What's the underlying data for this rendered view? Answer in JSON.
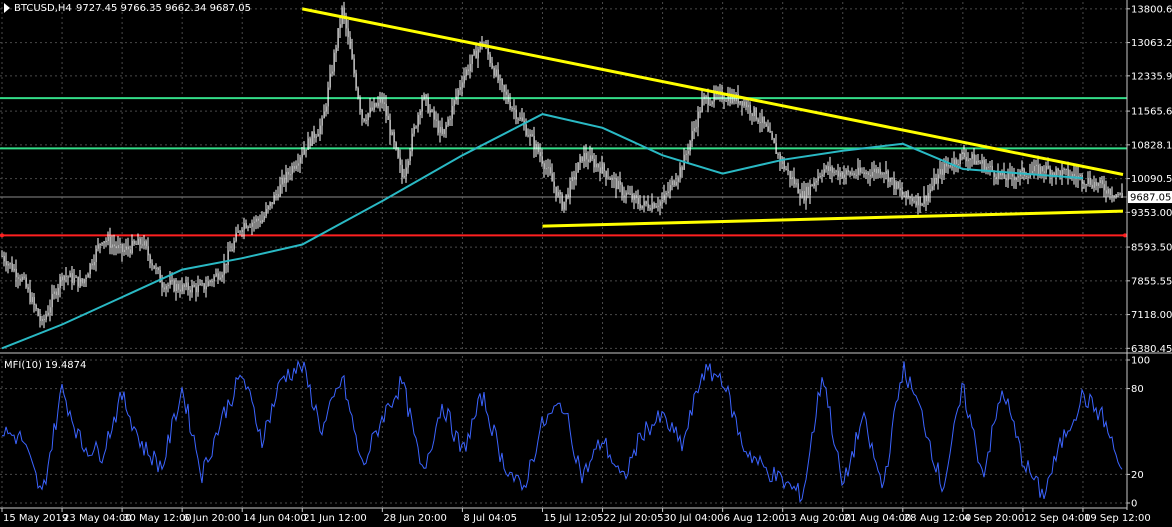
{
  "symbol_header": "BTCUSD,H4",
  "ohlc_header": "9727.45 9766.35 9662.34 9687.05",
  "indicator_header": "MFI(10) 19.4874",
  "last_price_label": "9687.05",
  "colors": {
    "background": "#000000",
    "grid": "#4a4a4a",
    "candles": "#ffffff",
    "moving_average": "#2ab9c4",
    "trendlines": "#ffff00",
    "horizontal_levels": "#33dd88",
    "support_level": "#ff2020",
    "mfi_line": "#3c64ff"
  },
  "chart_data": [
    {
      "type": "candlestick",
      "title": "BTCUSD,H4",
      "y_ticks": [
        "13800.65",
        "13063.25",
        "12335.90",
        "11565.65",
        "10828.10",
        "10090.55",
        "9353.00",
        "8593.50",
        "7855.55",
        "7118.00",
        "6380.45"
      ],
      "ylim": [
        6300,
        13950
      ],
      "x_ticks": [
        "15 May 2019",
        "23 May 04:00",
        "30 May 12:00",
        "6 Jun 20:00",
        "14 Jun 04:00",
        "21 Jun 12:00",
        "28 Jun 20:00",
        "8 Jul 04:05",
        "15 Jul 12:05",
        "22 Jul 20:05",
        "30 Jul 04:00",
        "6 Aug 12:00",
        "13 Aug 20:00",
        "21 Aug 04:00",
        "28 Aug 12:00",
        "4 Sep 20:00",
        "12 Sep 04:00",
        "19 Sep 12:00"
      ],
      "grid": true,
      "price_path": [
        [
          "15 May 2019",
          8400
        ],
        [
          "18 May",
          7900
        ],
        [
          "20 May",
          6900
        ],
        [
          "23 May 04:00",
          8000
        ],
        [
          "26 May",
          7800
        ],
        [
          "28 May",
          8800
        ],
        [
          "30 May 12:00",
          8500
        ],
        [
          "1 Jun",
          8700
        ],
        [
          "3 Jun",
          7800
        ],
        [
          "6 Jun 20:00",
          7700
        ],
        [
          "9 Jun",
          7700
        ],
        [
          "12 Jun",
          8100
        ],
        [
          "14 Jun 04:00",
          9100
        ],
        [
          "17 Jun",
          9200
        ],
        [
          "19 Jun",
          10000
        ],
        [
          "21 Jun 12:00",
          10700
        ],
        [
          "23 Jun",
          11300
        ],
        [
          "26 Jun",
          13800
        ],
        [
          "27 Jun",
          11400
        ],
        [
          "28 Jun 20:00",
          11800
        ],
        [
          "1 Jul",
          10100
        ],
        [
          "3 Jul",
          11900
        ],
        [
          "5 Jul",
          11000
        ],
        [
          "8 Jul 04:05",
          12300
        ],
        [
          "10 Jul",
          13100
        ],
        [
          "11 Jul",
          12000
        ],
        [
          "13 Jul",
          11300
        ],
        [
          "15 Jul 12:05",
          10500
        ],
        [
          "17 Jul",
          9500
        ],
        [
          "19 Jul",
          10600
        ],
        [
          "22 Jul 20:05",
          10300
        ],
        [
          "25 Jul",
          9800
        ],
        [
          "28 Jul",
          9500
        ],
        [
          "30 Jul 04:00",
          9600
        ],
        [
          "2 Aug",
          10400
        ],
        [
          "4 Aug",
          11800
        ],
        [
          "6 Aug 12:00",
          11900
        ],
        [
          "9 Aug",
          11800
        ],
        [
          "11 Aug",
          11300
        ],
        [
          "13 Aug 20:00",
          10400
        ],
        [
          "15 Aug",
          9700
        ],
        [
          "17 Aug",
          10300
        ],
        [
          "21 Aug 04:00",
          10200
        ],
        [
          "23 Aug",
          10200
        ],
        [
          "26 Aug",
          10300
        ],
        [
          "28 Aug 12:00",
          9700
        ],
        [
          "31 Aug",
          9600
        ],
        [
          "2 Sep",
          10300
        ],
        [
          "4 Sep 20:00",
          10600
        ],
        [
          "7 Sep",
          10400
        ],
        [
          "10 Sep",
          10100
        ],
        [
          "12 Sep 04:00",
          10200
        ],
        [
          "15 Sep",
          10300
        ],
        [
          "17 Sep",
          10200
        ],
        [
          "19 Sep 12:00",
          10100
        ],
        [
          "20 Sep",
          9900
        ],
        [
          "21 Sep",
          9687.05
        ]
      ],
      "moving_average": [
        [
          "15 May 2019",
          6380
        ],
        [
          "23 May 04:00",
          6900
        ],
        [
          "30 May 12:00",
          7500
        ],
        [
          "6 Jun 20:00",
          8100
        ],
        [
          "14 Jun 04:00",
          8350
        ],
        [
          "21 Jun 12:00",
          8650
        ],
        [
          "28 Jun 20:00",
          9600
        ],
        [
          "8 Jul 04:05",
          10600
        ],
        [
          "15 Jul 12:05",
          11500
        ],
        [
          "22 Jul 20:05",
          11200
        ],
        [
          "30 Jul 04:00",
          10600
        ],
        [
          "6 Aug 12:00",
          10200
        ],
        [
          "13 Aug 20:00",
          10500
        ],
        [
          "21 Aug 04:00",
          10700
        ],
        [
          "28 Aug 12:00",
          10850
        ],
        [
          "4 Sep 20:00",
          10300
        ],
        [
          "12 Sep 04:00",
          10200
        ],
        [
          "19 Sep 12:00",
          10100
        ]
      ],
      "horizontal_levels": [
        11850,
        10750
      ],
      "support_level": 8850,
      "trendlines": [
        {
          "from": [
            "21 Jun 12:00",
            13800
          ],
          "to": [
            "21 Sep",
            10180
          ]
        },
        {
          "from": [
            "15 Jul 12:05",
            9050
          ],
          "to": [
            "21 Sep",
            9380
          ]
        }
      ]
    },
    {
      "type": "line",
      "title": "MFI(10) 19.4874",
      "y_ticks": [
        "100",
        "80",
        "20",
        "0"
      ],
      "ylim": [
        0,
        100
      ],
      "grid": true,
      "mfi_path": [
        [
          "15 May 2019",
          50
        ],
        [
          "18 May",
          45
        ],
        [
          "20 May",
          5
        ],
        [
          "23 May 04:00",
          80
        ],
        [
          "26 May",
          40
        ],
        [
          "28 May",
          35
        ],
        [
          "30 May 12:00",
          75
        ],
        [
          "1 Jun",
          40
        ],
        [
          "3 Jun",
          25
        ],
        [
          "6 Jun 20:00",
          80
        ],
        [
          "9 Jun",
          20
        ],
        [
          "12 Jun",
          60
        ],
        [
          "14 Jun 04:00",
          90
        ],
        [
          "17 Jun",
          45
        ],
        [
          "19 Jun",
          88
        ],
        [
          "21 Jun 12:00",
          96
        ],
        [
          "23 Jun",
          50
        ],
        [
          "26 Jun",
          88
        ],
        [
          "27 Jun",
          25
        ],
        [
          "28 Jun 20:00",
          60
        ],
        [
          "1 Jul",
          85
        ],
        [
          "3 Jul",
          20
        ],
        [
          "5 Jul",
          70
        ],
        [
          "8 Jul 04:05",
          35
        ],
        [
          "10 Jul",
          75
        ],
        [
          "11 Jul",
          30
        ],
        [
          "13 Jul",
          8
        ],
        [
          "15 Jul 12:05",
          55
        ],
        [
          "17 Jul",
          70
        ],
        [
          "19 Jul",
          18
        ],
        [
          "22 Jul 20:05",
          45
        ],
        [
          "25 Jul",
          15
        ],
        [
          "28 Jul",
          50
        ],
        [
          "30 Jul 04:00",
          60
        ],
        [
          "2 Aug",
          40
        ],
        [
          "4 Aug",
          92
        ],
        [
          "6 Aug 12:00",
          88
        ],
        [
          "9 Aug",
          40
        ],
        [
          "11 Aug",
          25
        ],
        [
          "13 Aug 20:00",
          15
        ],
        [
          "15 Aug",
          5
        ],
        [
          "17 Aug",
          92
        ],
        [
          "21 Aug 04:00",
          10
        ],
        [
          "23 Aug",
          60
        ],
        [
          "26 Aug",
          10
        ],
        [
          "28 Aug 12:00",
          95
        ],
        [
          "31 Aug",
          60
        ],
        [
          "2 Sep",
          10
        ],
        [
          "4 Sep 20:00",
          80
        ],
        [
          "7 Sep",
          20
        ],
        [
          "10 Sep",
          80
        ],
        [
          "12 Sep 04:00",
          30
        ],
        [
          "15 Sep",
          5
        ],
        [
          "17 Sep",
          45
        ],
        [
          "19 Sep 12:00",
          75
        ],
        [
          "20 Sep",
          60
        ],
        [
          "21 Sep",
          19.4874
        ]
      ]
    }
  ]
}
